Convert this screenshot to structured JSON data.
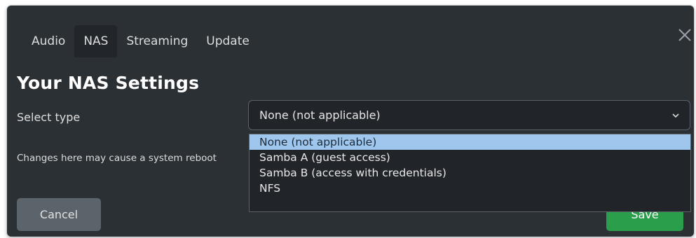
{
  "tabs": [
    {
      "label": "Audio"
    },
    {
      "label": "NAS"
    },
    {
      "label": "Streaming"
    },
    {
      "label": "Update"
    }
  ],
  "active_tab": "NAS",
  "page_title": "Your NAS Settings",
  "select": {
    "label": "Select type",
    "value": "None (not applicable)",
    "options": [
      {
        "label": "None (not applicable)"
      },
      {
        "label": "Samba A (guest access)"
      },
      {
        "label": "Samba B (access with credentials)"
      },
      {
        "label": "NFS"
      }
    ]
  },
  "note": "Changes here may cause a system reboot",
  "buttons": {
    "cancel": "Cancel",
    "save": "Save"
  },
  "icons": {
    "close": "close-icon",
    "chevron": "chevron-down-icon"
  },
  "colors": {
    "dialog_bg": "#2b3035",
    "selected_option": "#9fc7ee",
    "save_button": "#2a9e4a",
    "cancel_button": "#5b636b"
  }
}
